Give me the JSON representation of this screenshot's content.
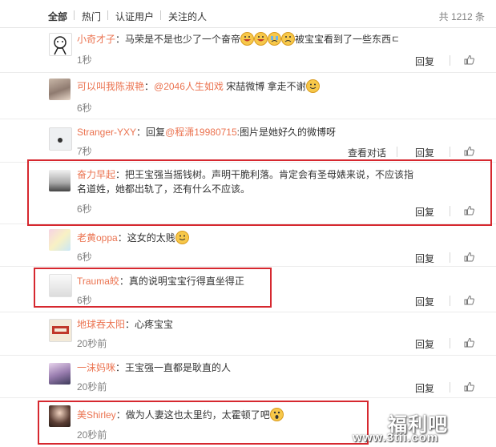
{
  "tabs": [
    "全部",
    "热门",
    "认证用户",
    "关注的人"
  ],
  "total": "共 1212 条",
  "actions": {
    "reply": "回复",
    "view_conversation": "查看对话"
  },
  "comments": [
    {
      "user": "小奇才子",
      "sep": "：",
      "text": "马荣是不是也少了一个奋帝",
      "text2": "被宝宝看到了一些东西ㄷ",
      "time": "1秒",
      "emoji_count": 4
    },
    {
      "user": "可以叫我陈淑艳",
      "sep": "：",
      "mention": "@2046人生如戏",
      "text": " 宋喆微博 拿走不谢",
      "time": "6秒",
      "emoji_count": 1
    },
    {
      "user": "Stranger-YXY",
      "sep": "：回复",
      "mention": "@程潇19980715",
      "text": ":图片是她好久的微博呀",
      "time": "7秒"
    },
    {
      "user": "奋力早起",
      "sep": "：",
      "text": "把王宝强当摇钱树。声明干脆利落。肯定会有圣母婊来说，不应该指名道姓，她都出轨了，还有什么不应该。",
      "time": "6秒"
    },
    {
      "user": "老黄oppa",
      "sep": "：",
      "text": "这女的太贱",
      "time": "6秒",
      "emoji_count": 1
    },
    {
      "user": "Trauma皎",
      "sep": "：",
      "text": "真的说明宝宝行得直坐得正",
      "time": "6秒"
    },
    {
      "user": "地球吞太阳",
      "sep": "：",
      "text": "心疼宝宝",
      "time": "20秒前"
    },
    {
      "user": "一沫妈咪",
      "sep": "：",
      "text": "王宝强一直都是耿直的人",
      "time": "20秒前"
    },
    {
      "user": "美Shirley",
      "sep": "：",
      "text": "做为人妻这也太里约，太霍顿了吧",
      "time": "20秒前",
      "emoji_count": 1
    }
  ],
  "watermark": {
    "line1": "福利吧",
    "line2": "www.3tii.com"
  },
  "colors": {
    "username": "#eb7350",
    "highlight_box": "#d6282f"
  }
}
